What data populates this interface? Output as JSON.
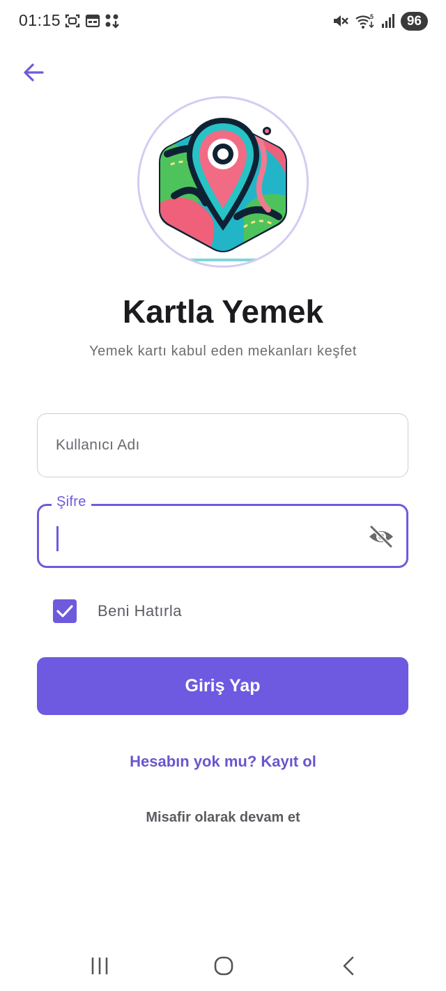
{
  "status_bar": {
    "time": "01:15",
    "battery": "96",
    "icons": [
      "screenshot-icon",
      "calendar-icon",
      "apps-icon",
      "mute-icon",
      "wifi-icon",
      "signal-icon"
    ]
  },
  "header": {
    "back_icon": "arrow-left-icon"
  },
  "app": {
    "title": "Kartla Yemek",
    "subtitle": "Yemek kartı kabul eden mekanları keşfet"
  },
  "form": {
    "username_placeholder": "Kullanıcı Adı",
    "password_label": "Şifre",
    "password_value": "",
    "remember_label": "Beni Hatırla",
    "remember_checked": true,
    "login_button": "Giriş Yap",
    "register_link": "Hesabın yok mu? Kayıt ol",
    "guest_link": "Misafir olarak devam et"
  },
  "colors": {
    "accent": "#6e5bdb",
    "button": "#6d5ae0",
    "link": "#6b55cf"
  },
  "nav": {
    "icons": [
      "recents-icon",
      "home-icon",
      "back-icon"
    ]
  }
}
